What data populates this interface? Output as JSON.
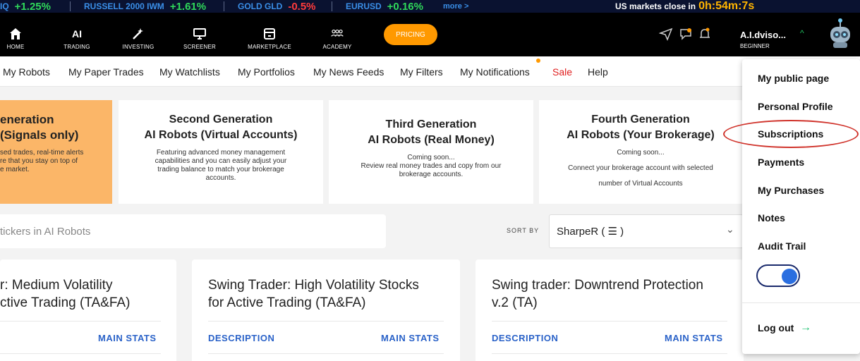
{
  "ticker": {
    "items": [
      {
        "name": "IQ",
        "change": "+1.25%",
        "dir": "up"
      },
      {
        "name": "RUSSELL 2000 IWM",
        "change": "+1.61%",
        "dir": "up"
      },
      {
        "name": "GOLD GLD",
        "change": "-0.5%",
        "dir": "down"
      },
      {
        "name": "EURUSD",
        "change": "+0.16%",
        "dir": "up"
      }
    ],
    "more_label": "more >",
    "market_close_label": "US markets close in",
    "market_close_time": "0h:54m:7s"
  },
  "nav": {
    "items": [
      {
        "label": "HOME",
        "icon": "home-icon"
      },
      {
        "label": "TRADING",
        "icon": "ai-text-icon",
        "text": "AI"
      },
      {
        "label": "INVESTING",
        "icon": "wand-icon"
      },
      {
        "label": "SCREENER",
        "icon": "monitor-icon"
      },
      {
        "label": "MARKETPLACE",
        "icon": "store-icon"
      },
      {
        "label": "ACADEMY",
        "icon": "people-icon"
      }
    ],
    "pricing_label": "PRICING",
    "user_name": "A.I.dviso...",
    "user_level": "BEGINNER"
  },
  "subnav": {
    "items": [
      "My Robots",
      "My Paper Trades",
      "My Watchlists",
      "My Portfolios",
      "My News Feeds",
      "My Filters",
      "My Notifications",
      "Sale",
      "Help"
    ]
  },
  "generations": [
    {
      "title1": "eneration",
      "title2": "(Signals only)",
      "desc": [
        "sed trades, real-time alerts",
        "re that you stay on top of",
        "e market."
      ]
    },
    {
      "title1": "Second Generation",
      "title2": "AI Robots (Virtual Accounts)",
      "desc": [
        "Featuring advanced money management",
        "capabilities and you can easily adjust your",
        "trading balance to match your brokerage",
        "accounts."
      ]
    },
    {
      "title1": "Third Generation",
      "title2": "AI Robots (Real Money)",
      "desc": [
        "Coming soon...",
        "Review real money trades and copy from our",
        "brokerage accounts."
      ]
    },
    {
      "title1": "Fourth Generation",
      "title2": "AI Robots (Your Brokerage)",
      "desc": [
        "Coming soon...",
        "",
        "Connect your brokerage account with selected",
        "",
        "number of Virtual Accounts"
      ]
    }
  ],
  "search": {
    "placeholder": "tickers in AI Robots"
  },
  "sort": {
    "label": "SORT BY",
    "value": "SharpeR ( ☰ )"
  },
  "robots": [
    {
      "title1": "r: Medium Volatility",
      "title2": "ctive Trading (TA&FA)",
      "tab1": "",
      "tab2": "MAIN STATS"
    },
    {
      "title1": "Swing Trader: High Volatility Stocks",
      "title2": "for Active Trading (TA&FA)",
      "tab1": "DESCRIPTION",
      "tab2": "MAIN STATS"
    },
    {
      "title1": "Swing trader: Downtrend Protection",
      "title2": "v.2 (TA)",
      "tab1": "DESCRIPTION",
      "tab2": "MAIN STATS"
    }
  ],
  "menu": {
    "items": [
      "My public page",
      "Personal Profile",
      "Subscriptions",
      "Payments",
      "My Purchases",
      "Notes",
      "Audit Trail"
    ],
    "logout": "Log out"
  },
  "colors": {
    "accent": "#ff9900",
    "link": "#2a62c8",
    "up": "#2fd85a",
    "down": "#ff3b3b"
  }
}
